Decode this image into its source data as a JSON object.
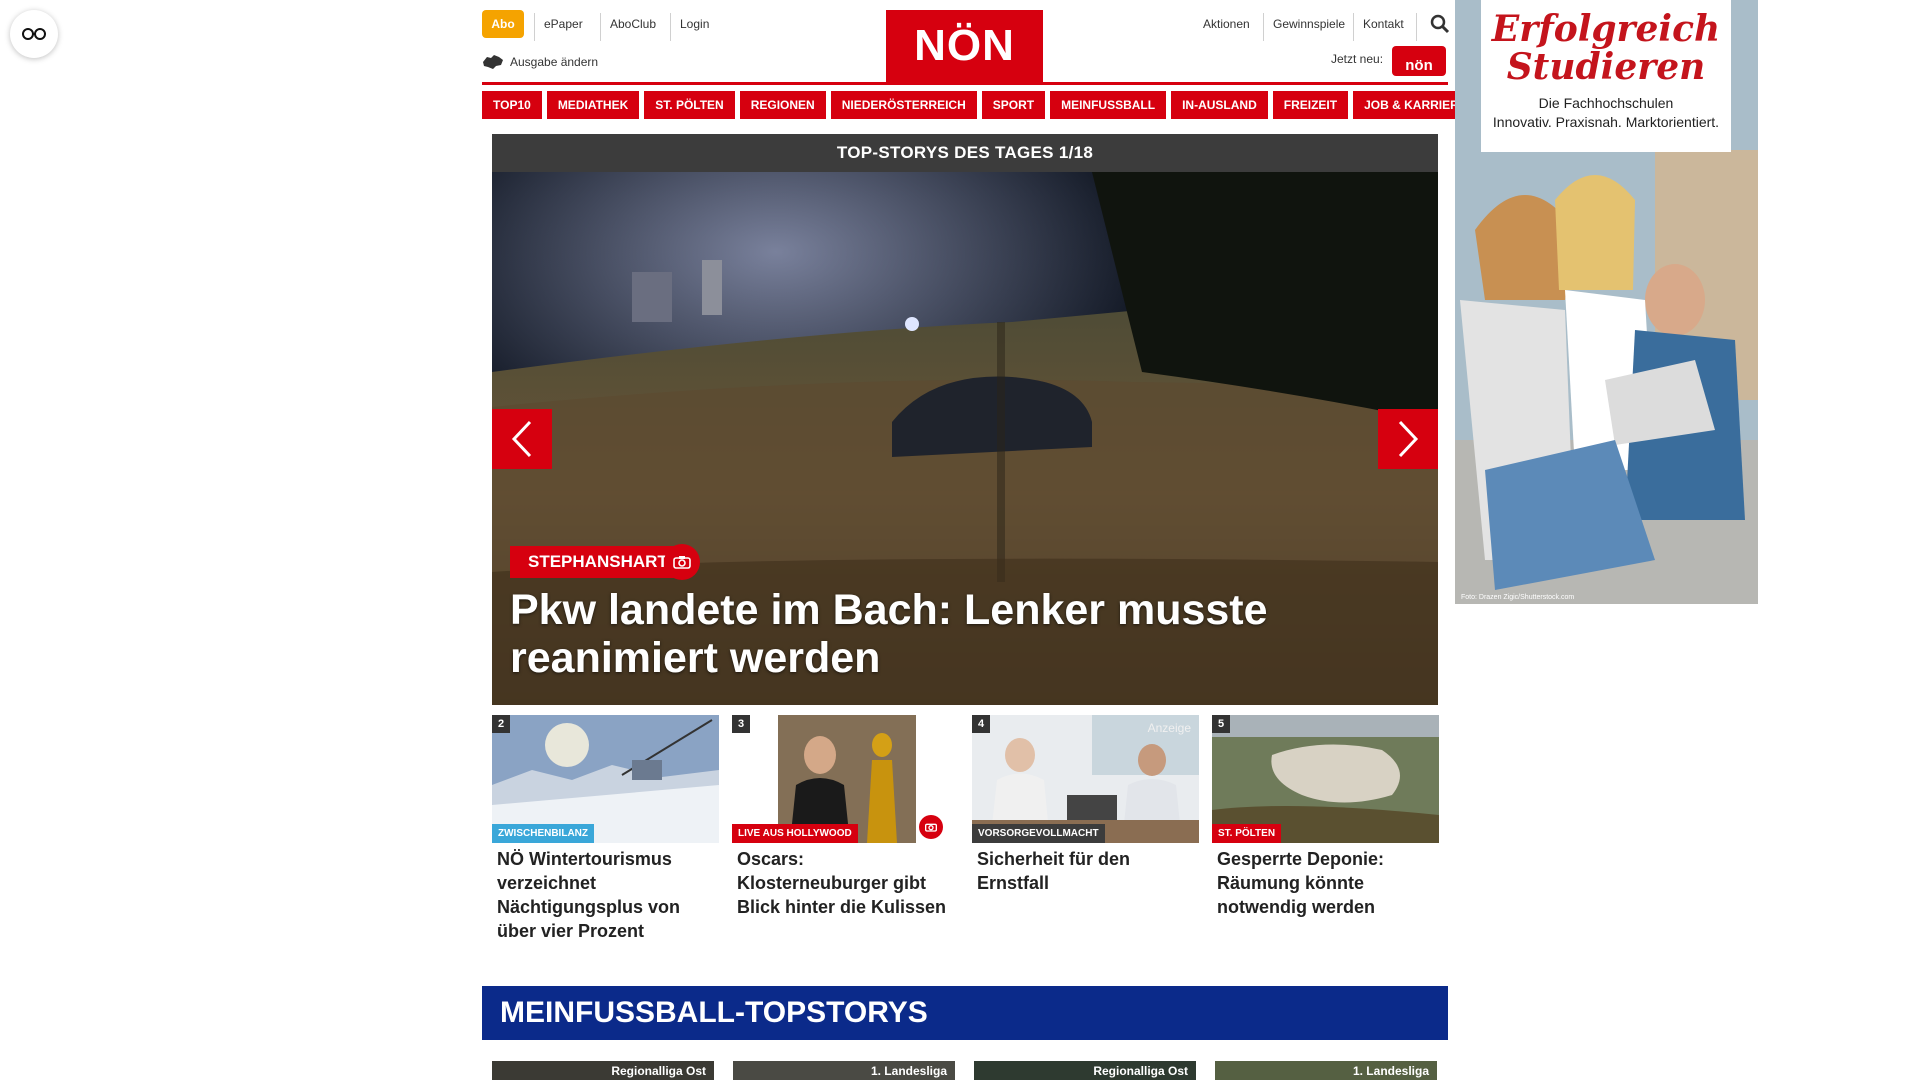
{
  "reader_button": {
    "icon": "glasses-icon"
  },
  "header": {
    "abo_label": "Abo",
    "links_left": [
      "ePaper",
      "AboClub",
      "Login"
    ],
    "ausgabe_label": "Ausgabe ändern",
    "logo_text": "NÖN",
    "links_right": [
      "Aktionen",
      "Gewinnspiele",
      "Kontakt"
    ],
    "jetzt_neu_label": "Jetzt neu:",
    "jetzt_badge": "nön",
    "brand_color": "#d6000f"
  },
  "nav": {
    "items": [
      "TOP10",
      "MEDIATHEK",
      "ST. PÖLTEN",
      "REGIONEN",
      "NIEDERÖSTERREICH",
      "SPORT",
      "MEINFUSSBALL",
      "IN-AUSLAND",
      "FREIZEIT",
      "JOB & KARRIERE"
    ]
  },
  "hero": {
    "header": "TOP-STORYS DES TAGES 1/18",
    "tag": "STEPHANSHART",
    "title": "Pkw landete im Bach: Lenker musste reanimiert werden"
  },
  "cards": [
    {
      "num": "2",
      "tag": "ZWISCHENBILANZ",
      "tag_color": "#3aa7d9",
      "title": "NÖ Wintertourismus verzeichnet Nächtigungsplus von über vier Prozent"
    },
    {
      "num": "3",
      "tag": "LIVE AUS HOLLYWOOD",
      "tag_color": "#d6000f",
      "title": "Oscars: Klosterneuburger gibt Blick hinter die Kulissen"
    },
    {
      "num": "4",
      "tag": "VORSORGEVOLLMACHT",
      "tag_color": "#3c3c3c",
      "title": "Sicherheit für den Ernstfall",
      "overlay": "Anzeige"
    },
    {
      "num": "5",
      "tag": "ST. PÖLTEN",
      "tag_color": "#d6000f",
      "title": "Gesperrte Deponie: Räumung könnte notwendig werden"
    }
  ],
  "fussball": {
    "header": "MEINFUSSBALL-TOPSTORYS",
    "labels": [
      "Regionalliga Ost",
      "1. Landesliga",
      "Regionalliga Ost",
      "1. Landesliga"
    ]
  },
  "ad": {
    "title_line1": "Erfolgreich",
    "title_line2": "Studieren",
    "sub_line1": "Die Fachhochschulen",
    "sub_line2": "Innovativ. Praxisnah. Marktorientiert.",
    "credit": "Foto: Drazen Zigic/Shutterstock.com"
  }
}
